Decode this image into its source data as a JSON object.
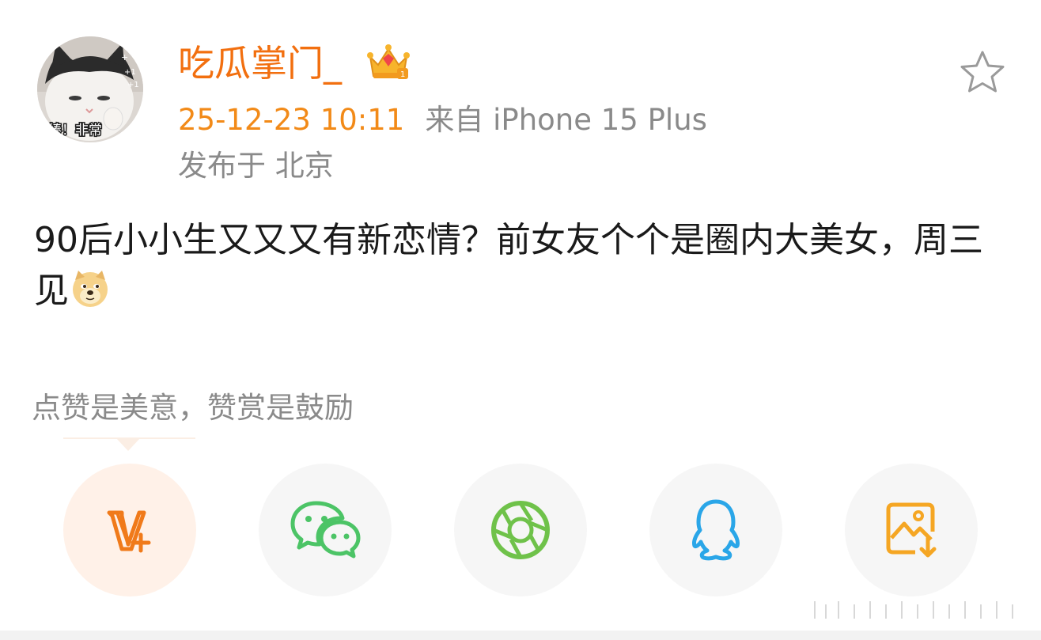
{
  "post": {
    "author": {
      "name": "吃瓜掌门_",
      "avatar_caption": "棒！非常"
    },
    "timestamp": "25-12-23 10:11",
    "source": "来自 iPhone 15 Plus",
    "location": "发布于 北京",
    "text": "90后小小生又又又有新恋情？前女友个个是圈内大美女，周三见"
  },
  "reward": {
    "prompt": "点赞是美意，赞赏是鼓励"
  },
  "share_actions": [
    {
      "id": "vplus",
      "icon": "v-plus-icon",
      "color": "#f07a1a"
    },
    {
      "id": "wechat",
      "icon": "wechat-icon",
      "color": "#4cc466"
    },
    {
      "id": "moments",
      "icon": "moments-icon",
      "color": "#6fc24a"
    },
    {
      "id": "qq",
      "icon": "qq-icon",
      "color": "#2aa6e8"
    },
    {
      "id": "save",
      "icon": "save-image-icon",
      "color": "#f5a623"
    }
  ],
  "colors": {
    "brand": "#f26f0f",
    "timestamp": "#f28a18",
    "meta": "#8a8a8a",
    "text": "#1a1a1a"
  }
}
